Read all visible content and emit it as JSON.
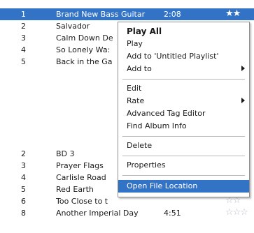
{
  "tracks": [
    {
      "num": "1",
      "title": "Brand New Bass Guitar",
      "time": "2:08",
      "stars": "★★",
      "selected": true
    },
    {
      "num": "2",
      "title": "Salvador",
      "time": "",
      "stars": "☆☆",
      "selected": false
    },
    {
      "num": "3",
      "title": "Calm Down De",
      "time": "",
      "stars": "☆☆",
      "selected": false
    },
    {
      "num": "4",
      "title": "So Lonely Wa:",
      "time": "",
      "stars": "☆☆",
      "selected": false
    },
    {
      "num": "5",
      "title": "Back in the Ga",
      "time": "",
      "stars": "☆☆",
      "selected": false
    },
    {
      "num": "2",
      "title": "BD 3",
      "time": "",
      "stars": "☆☆",
      "selected": false
    },
    {
      "num": "3",
      "title": "Prayer Flags",
      "time": "",
      "stars": "☆☆",
      "selected": false
    },
    {
      "num": "4",
      "title": "Carlisle Road",
      "time": "",
      "stars": "☆☆",
      "selected": false
    },
    {
      "num": "5",
      "title": "Red Earth",
      "time": "",
      "stars": "☆☆",
      "selected": false
    },
    {
      "num": "6",
      "title": "Too Close to t",
      "time": "",
      "stars": "☆☆",
      "selected": false
    },
    {
      "num": "8",
      "title": "Another Imperial Day",
      "time": "4:51",
      "stars": "☆☆☆",
      "selected": false
    }
  ],
  "context_menu": {
    "play_all": "Play All",
    "play": "Play",
    "add_to_untitled": "Add to 'Untitled Playlist'",
    "add_to": "Add to",
    "edit": "Edit",
    "rate": "Rate",
    "advanced_tag_editor": "Advanced Tag Editor",
    "find_album_info": "Find Album Info",
    "delete": "Delete",
    "properties": "Properties",
    "open_file_location": "Open File Location"
  },
  "colors": {
    "selection": "#3373c6",
    "empty_star": "#b9c2cc"
  }
}
